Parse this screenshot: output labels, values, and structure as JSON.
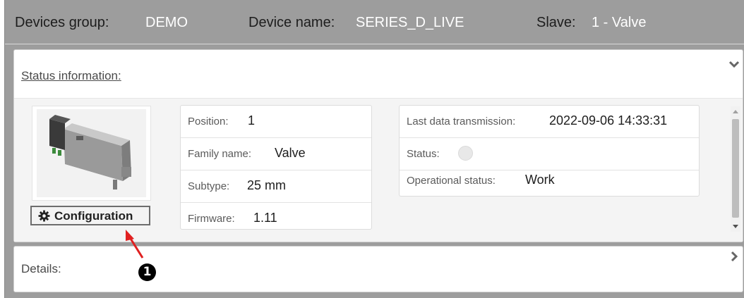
{
  "header": {
    "group_label": "Devices group:",
    "group_value": "DEMO",
    "device_label": "Device name:",
    "device_value": "SERIES_D_LIVE",
    "slave_label": "Slave:",
    "slave_value": "1 - Valve"
  },
  "status_panel": {
    "title": "Status information:",
    "collapse_icon": "chevron-down-icon",
    "configuration_button": "Configuration",
    "configuration_icon": "gear-icon",
    "device_info": [
      {
        "label": "Position:",
        "value": "1"
      },
      {
        "label": "Family name:",
        "value": "Valve"
      },
      {
        "label": "Subtype:",
        "value": "25 mm"
      },
      {
        "label": "Firmware:",
        "value": "1.11"
      }
    ],
    "transmission": {
      "last_label": "Last data transmission:",
      "last_value": "2022-09-06 14:33:31",
      "status_label": "Status:",
      "status_color": "#e8e8e8",
      "operational_label": "Operational status:",
      "operational_value": "Work"
    }
  },
  "details_panel": {
    "title": "Details:",
    "expand_icon": "chevron-right-icon"
  },
  "annotation": {
    "badge_text": "1",
    "arrow_color": "#e02020"
  },
  "colors": {
    "frame_bg": "#9d9d9d",
    "header_value": "#ffffff",
    "panel_bg": "#ffffff"
  }
}
